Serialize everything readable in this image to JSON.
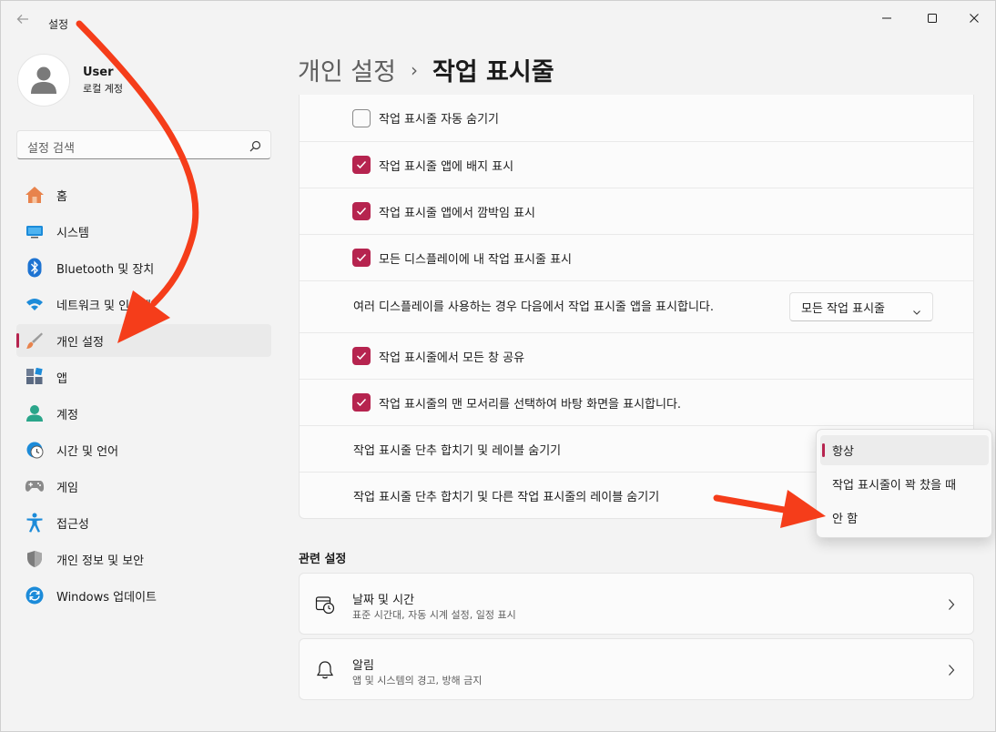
{
  "window": {
    "title": "설정",
    "back_icon": "back-arrow-icon",
    "controls": [
      "minimize-icon",
      "maximize-icon",
      "close-icon"
    ]
  },
  "profile": {
    "name": "User",
    "account_type": "로컬 계정"
  },
  "search": {
    "placeholder": "설정 검색",
    "icon": "search-icon"
  },
  "nav": {
    "items": [
      {
        "label": "홈",
        "icon": "home-icon",
        "active": false
      },
      {
        "label": "시스템",
        "icon": "system-icon",
        "active": false
      },
      {
        "label": "Bluetooth 및 장치",
        "icon": "bluetooth-icon",
        "active": false
      },
      {
        "label": "네트워크 및 인터넷",
        "icon": "wifi-icon",
        "active": false
      },
      {
        "label": "개인 설정",
        "icon": "brush-icon",
        "active": true
      },
      {
        "label": "앱",
        "icon": "apps-icon",
        "active": false
      },
      {
        "label": "계정",
        "icon": "account-icon",
        "active": false
      },
      {
        "label": "시간 및 언어",
        "icon": "clock-globe-icon",
        "active": false
      },
      {
        "label": "게임",
        "icon": "gamepad-icon",
        "active": false
      },
      {
        "label": "접근성",
        "icon": "accessibility-icon",
        "active": false
      },
      {
        "label": "개인 정보 및 보안",
        "icon": "shield-icon",
        "active": false
      },
      {
        "label": "Windows 업데이트",
        "icon": "update-icon",
        "active": false
      }
    ]
  },
  "breadcrumb": {
    "parent": "개인 설정",
    "separator": "›",
    "current": "작업 표시줄"
  },
  "taskbar_settings": {
    "rows": [
      {
        "type": "checkbox",
        "label": "작업 표시줄 자동 숨기기",
        "checked": false
      },
      {
        "type": "checkbox",
        "label": "작업 표시줄 앱에 배지 표시",
        "checked": true
      },
      {
        "type": "checkbox",
        "label": "작업 표시줄 앱에서 깜박임 표시",
        "checked": true
      },
      {
        "type": "checkbox",
        "label": "모든 디스플레이에 내 작업 표시줄 표시",
        "checked": true
      },
      {
        "type": "dropdown",
        "label": "여러 디스플레이를 사용하는 경우 다음에서 작업 표시줄 앱을 표시합니다.",
        "value": "모든 작업 표시줄"
      },
      {
        "type": "checkbox",
        "label": "작업 표시줄에서 모든 창 공유",
        "checked": true
      },
      {
        "type": "checkbox",
        "label": "작업 표시줄의 맨 모서리를 선택하여 바탕 화면을 표시합니다.",
        "checked": true
      },
      {
        "type": "select",
        "label": "작업 표시줄 단추 합치기 및 레이블 숨기기"
      },
      {
        "type": "select",
        "label": "작업 표시줄 단추 합치기 및 다른 작업 표시줄의 레이블 숨기기"
      }
    ]
  },
  "combine_flyout": {
    "options": [
      {
        "label": "항상",
        "selected": true
      },
      {
        "label": "작업 표시줄이 꽉 찼을 때",
        "selected": false
      },
      {
        "label": "안 함",
        "selected": false
      }
    ]
  },
  "related": {
    "heading": "관련 설정",
    "items": [
      {
        "title": "날짜 및 시간",
        "subtitle": "표준 시간대, 자동 시계 설정, 일정 표시",
        "icon": "calendar-clock-icon"
      },
      {
        "title": "알림",
        "subtitle": "앱 및 시스템의 경고, 방해 금지",
        "icon": "bell-icon"
      }
    ]
  },
  "colors": {
    "accent": "#b6244f",
    "annotation_arrow": "#f53d1a",
    "background": "#f3f3f3",
    "card": "#fbfbfb"
  }
}
